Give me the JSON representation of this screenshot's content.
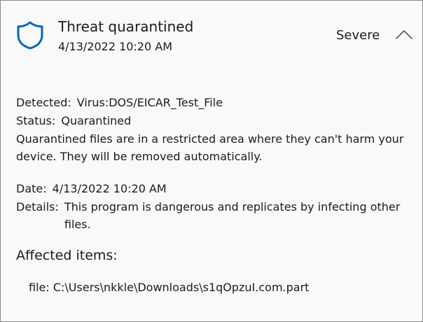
{
  "header": {
    "title": "Threat quarantined",
    "timestamp": "4/13/2022 10:20 AM",
    "severity": "Severe",
    "icon": "shield-icon",
    "toggle_icon": "chevron-up-icon",
    "accent_color": "#0067c0"
  },
  "details": {
    "detected_label": "Detected:",
    "detected_value": "Virus:DOS/EICAR_Test_File",
    "status_label": "Status:",
    "status_value": "Quarantined",
    "description": "Quarantined files are in a restricted area where they can't harm your device. They will be removed automatically.",
    "date_label": "Date:",
    "date_value": "4/13/2022 10:20 AM",
    "details_label": "Details:",
    "details_value": "This program is dangerous and replicates by infecting other files."
  },
  "affected": {
    "heading": "Affected items:",
    "items": [
      "file: C:\\Users\\nkkle\\Downloads\\s1qOpzuI.com.part"
    ]
  }
}
